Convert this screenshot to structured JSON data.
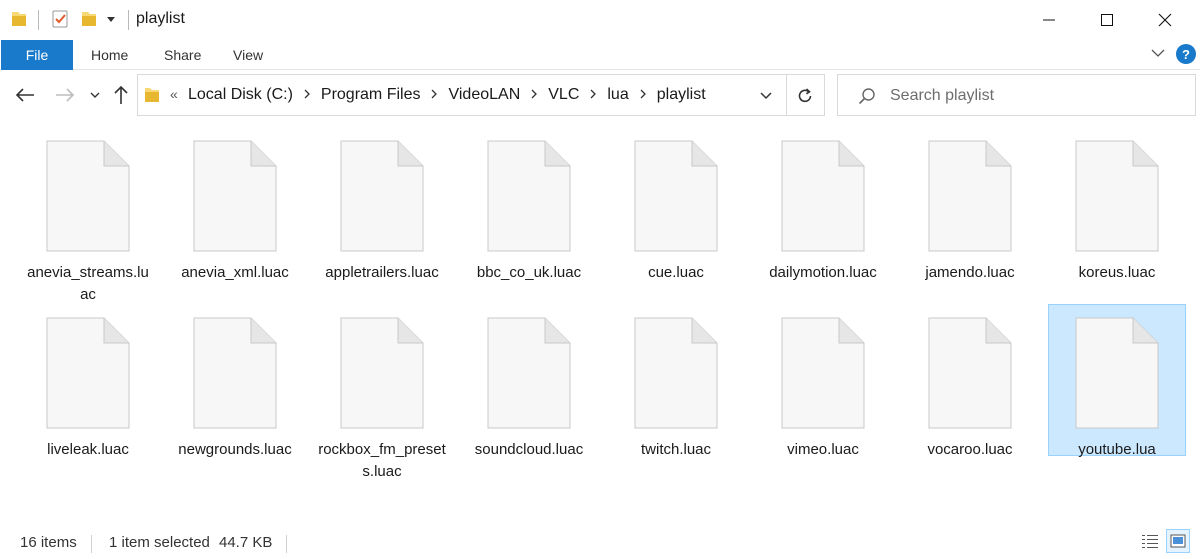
{
  "window": {
    "title": "playlist"
  },
  "ribbon": {
    "tabs": [
      {
        "label": "File"
      },
      {
        "label": "Home"
      },
      {
        "label": "Share"
      },
      {
        "label": "View"
      }
    ],
    "help_label": "?"
  },
  "navigation": {
    "overflow_label": "«",
    "breadcrumbs": [
      "Local Disk (C:)",
      "Program Files",
      "VideoLAN",
      "VLC",
      "lua",
      "playlist"
    ]
  },
  "search": {
    "placeholder": "Search playlist"
  },
  "files": [
    {
      "name": "anevia_streams.luac",
      "selected": false
    },
    {
      "name": "anevia_xml.luac",
      "selected": false
    },
    {
      "name": "appletrailers.luac",
      "selected": false
    },
    {
      "name": "bbc_co_uk.luac",
      "selected": false
    },
    {
      "name": "cue.luac",
      "selected": false
    },
    {
      "name": "dailymotion.luac",
      "selected": false
    },
    {
      "name": "jamendo.luac",
      "selected": false
    },
    {
      "name": "koreus.luac",
      "selected": false
    },
    {
      "name": "liveleak.luac",
      "selected": false
    },
    {
      "name": "newgrounds.luac",
      "selected": false
    },
    {
      "name": "rockbox_fm_presets.luac",
      "selected": false
    },
    {
      "name": "soundcloud.luac",
      "selected": false
    },
    {
      "name": "twitch.luac",
      "selected": false
    },
    {
      "name": "vimeo.luac",
      "selected": false
    },
    {
      "name": "vocaroo.luac",
      "selected": false
    },
    {
      "name": "youtube.lua",
      "selected": true
    }
  ],
  "status": {
    "item_count": "16 items",
    "selection": "1 item selected",
    "size": "44.7 KB"
  },
  "colors": {
    "accent": "#1979ca",
    "selection_bg": "#cce8ff",
    "selection_border": "#99d1ff",
    "folder": "#f8d775"
  },
  "icons": {
    "quick_access_folder": "folder-icon",
    "properties": "checkmark-clipboard-icon",
    "new_folder": "new-folder-icon",
    "back": "arrow-left-icon",
    "forward": "arrow-right-icon",
    "up": "arrow-up-icon",
    "refresh": "refresh-icon",
    "search": "search-icon",
    "file": "blank-file-icon"
  }
}
